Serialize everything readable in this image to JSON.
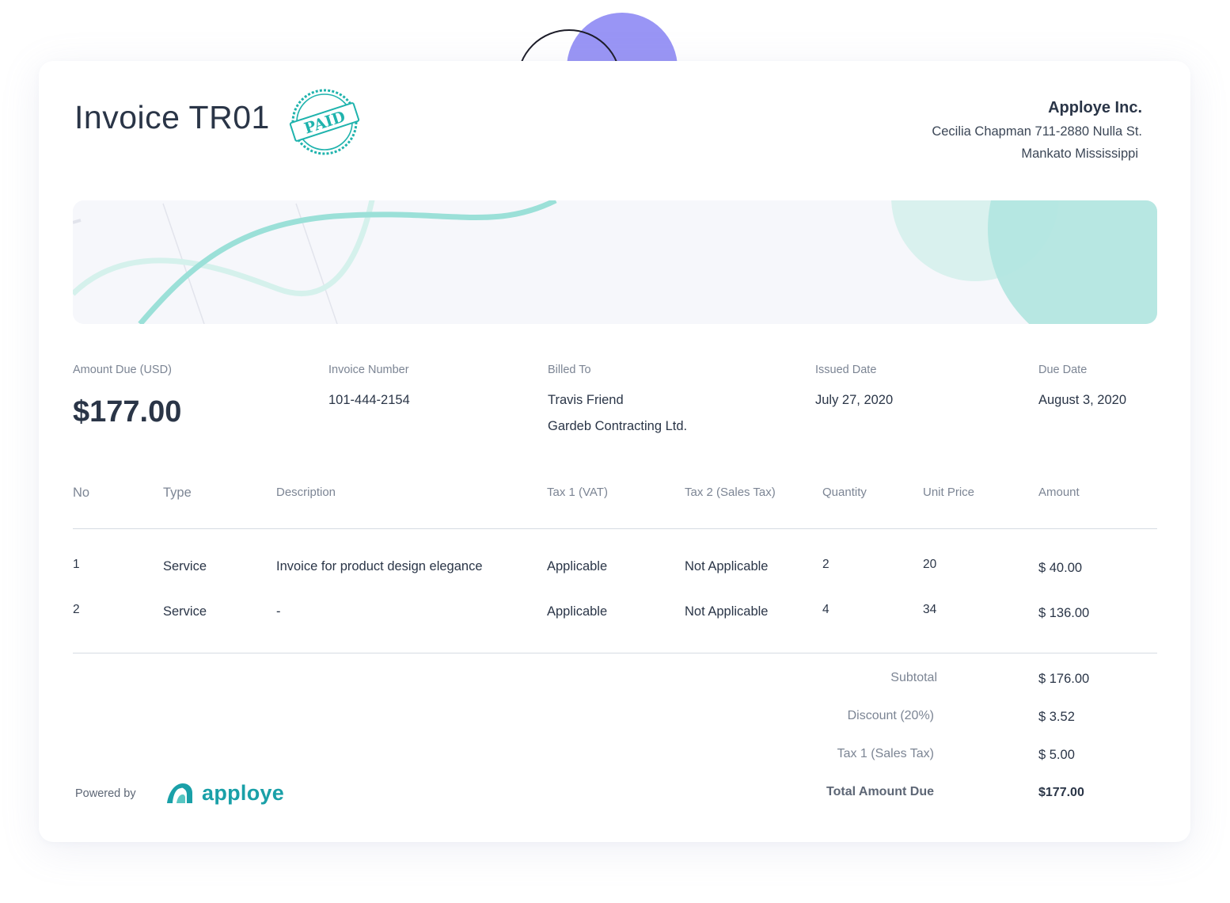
{
  "invoice": {
    "title": "Invoice TR01",
    "status_stamp": "PAID",
    "colors": {
      "accent": "#1fb3ad",
      "decor_purple": "#9995f5",
      "text": "#2a3547",
      "muted": "#7c8594"
    }
  },
  "company": {
    "name": "Apploye Inc.",
    "address_line1": "Cecilia Chapman 711-2880 Nulla St.",
    "address_line2": "Mankato Mississippi"
  },
  "summary": {
    "amount_due_label": "Amount Due (USD)",
    "amount_due_value": "$177.00",
    "invoice_number_label": "Invoice Number",
    "invoice_number_value": "101-444-2154",
    "billed_to_label": "Billed To",
    "billed_to_name": "Travis Friend",
    "billed_to_company": "Gardeb Contracting Ltd.",
    "issued_date_label": "Issued Date",
    "issued_date_value": "July 27, 2020",
    "due_date_label": "Due Date",
    "due_date_value": "August 3, 2020"
  },
  "table": {
    "headers": [
      "No",
      "Type",
      "Description",
      "Tax 1 (VAT)",
      "Tax 2 (Sales Tax)",
      "Quantity",
      "Unit Price",
      "Amount"
    ],
    "rows": [
      {
        "no": "1",
        "type": "Service",
        "description": "Invoice for product design elegance",
        "tax1": "Applicable",
        "tax2": "Not Applicable",
        "quantity": "2",
        "unit_price": "20",
        "amount": "$ 40.00"
      },
      {
        "no": "2",
        "type": "Service",
        "description": "-",
        "tax1": "Applicable",
        "tax2": "Not Applicable",
        "quantity": "4",
        "unit_price": "34",
        "amount": "$ 136.00"
      }
    ]
  },
  "totals": {
    "subtotal_label": "Subtotal",
    "subtotal_value": "$ 176.00",
    "discount_label": "Discount (20%)",
    "discount_value": "$ 3.52",
    "tax_label": "Tax 1 (Sales Tax)",
    "tax_value": "$ 5.00",
    "total_label": "Total Amount Due",
    "total_value": "$177.00"
  },
  "footer": {
    "powered_by": "Powered by",
    "brand": "apploye",
    "brand_icon": "apploye-logo-icon"
  }
}
